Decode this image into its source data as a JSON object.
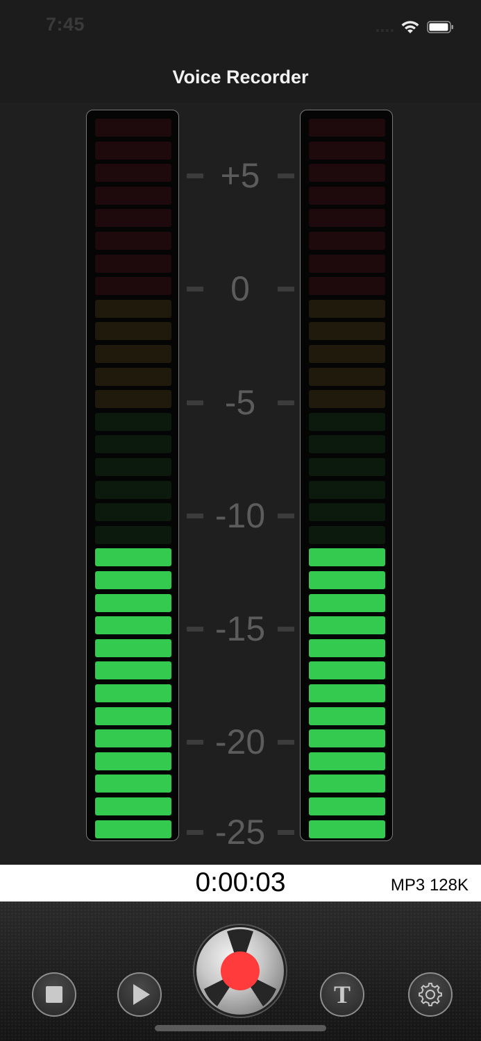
{
  "status_bar": {
    "time": "7:45"
  },
  "nav": {
    "title": "Voice Recorder"
  },
  "meter": {
    "segments_total": 32,
    "segments_lit": 13,
    "level_fraction": 0.406,
    "colors": {
      "lit_green": "#34c94f",
      "dim_green": "#0b1a0d",
      "dim_amber": "#1f1a0b",
      "dim_red": "#1e0a0c"
    },
    "scale_labels": [
      "+5",
      "0",
      "-5",
      "-10",
      "-15",
      "-20",
      "-25"
    ]
  },
  "info": {
    "timer": "0:00:03",
    "format": "MP3 128K"
  },
  "toolbar": {
    "record_color": "#ff3b3b",
    "buttons": [
      "stop",
      "play",
      "record",
      "text",
      "settings"
    ]
  }
}
